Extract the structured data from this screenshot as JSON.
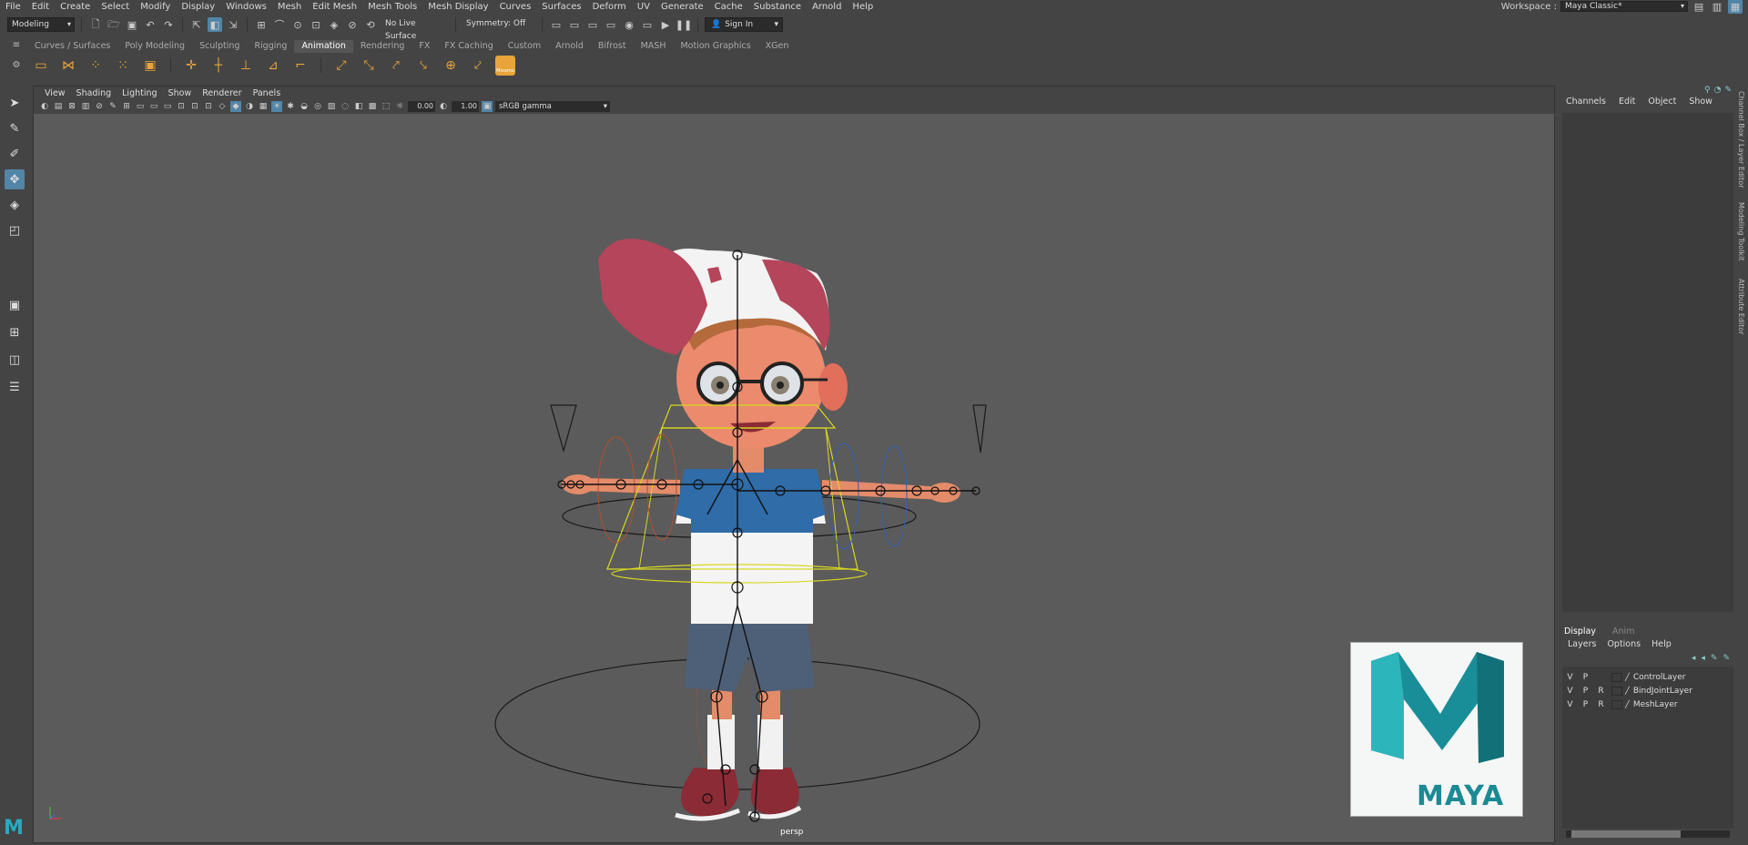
{
  "menubar": {
    "items": [
      "File",
      "Edit",
      "Create",
      "Select",
      "Modify",
      "Display",
      "Windows",
      "Mesh",
      "Edit Mesh",
      "Mesh Tools",
      "Mesh Display",
      "Curves",
      "Surfaces",
      "Deform",
      "UV",
      "Generate",
      "Cache",
      "Substance",
      "Arnold",
      "Help"
    ]
  },
  "workspace": {
    "label": "Workspace :",
    "value": "Maya Classic*"
  },
  "statusline": {
    "mode": "Modeling",
    "live_surface": "No Live Surface",
    "symmetry": "Symmetry: Off",
    "sign_in": "Sign In"
  },
  "shelf": {
    "tabs": [
      "Curves / Surfaces",
      "Poly Modeling",
      "Sculpting",
      "Rigging",
      "Animation",
      "Rendering",
      "FX",
      "FX Caching",
      "Custom",
      "Arnold",
      "Bifrost",
      "MASH",
      "Motion Graphics",
      "XGen"
    ],
    "active_tab": "Animation",
    "mixamo_label": "Mixamo"
  },
  "panel": {
    "menu": [
      "View",
      "Shading",
      "Lighting",
      "Show",
      "Renderer",
      "Panels"
    ],
    "exposure": "0.00",
    "gamma": "1.00",
    "color_space": "sRGB gamma",
    "camera": "persp"
  },
  "channel_box": {
    "menu": [
      "Channels",
      "Edit",
      "Object",
      "Show"
    ]
  },
  "layer_editor": {
    "tabs": [
      "Display",
      "Anim"
    ],
    "menu": [
      "Layers",
      "Options",
      "Help"
    ],
    "layers": [
      {
        "v": "V",
        "p": "P",
        "r": "",
        "name": "ControlLayer"
      },
      {
        "v": "V",
        "p": "P",
        "r": "R",
        "name": "BindJointLayer"
      },
      {
        "v": "V",
        "p": "P",
        "r": "R",
        "name": "MeshLayer"
      }
    ]
  },
  "side_tabs": [
    "Channel Box / Layer Editor",
    "Modeling Toolkit",
    "Attribute Editor"
  ],
  "logo": {
    "text": "MAYA"
  },
  "colors": {
    "accent": "#5285a6",
    "maya_teal": "#1c8a94",
    "viewport_bg": "#5b5b5b"
  }
}
